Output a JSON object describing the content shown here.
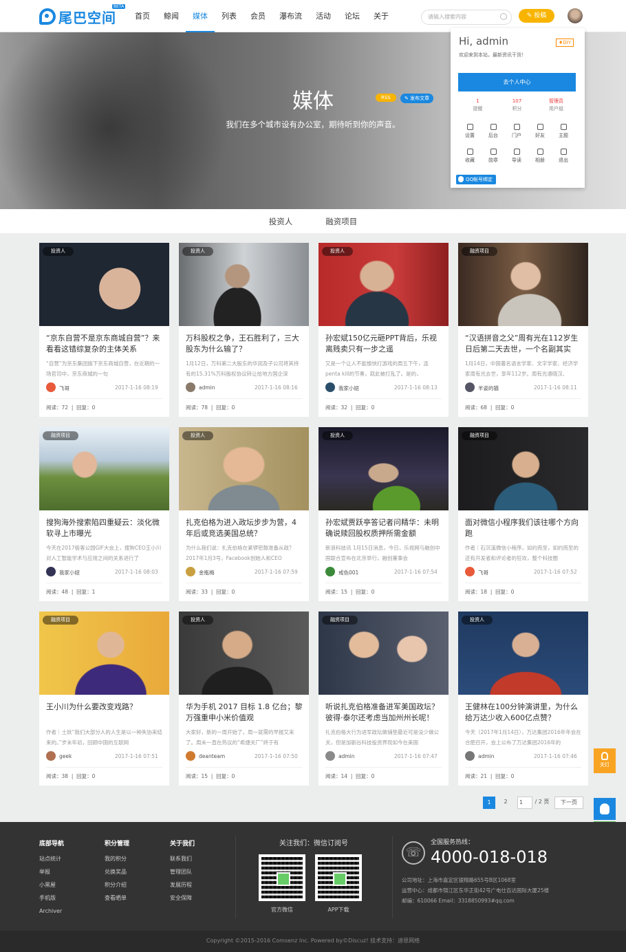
{
  "header": {
    "logo": "尾巴空间",
    "beta": "BETA",
    "nav": [
      "首页",
      "鲸闻",
      "媒体",
      "列表",
      "会员",
      "瀑布流",
      "活动",
      "论坛",
      "关于"
    ],
    "search_placeholder": "请输入搜索内容",
    "post_label": "投稿"
  },
  "hero": {
    "title": "媒体",
    "subtitle": "我们在多个城市设有办公室，期待听到你的声音。",
    "rss": "RSS",
    "publish": "发布文章"
  },
  "user_menu": {
    "greeting": "Hi, admin",
    "diy": "♦DIY",
    "welcome": "欢迎来到本站，最新资讯干货！",
    "center_btn": "去个人中心",
    "stats": [
      {
        "value": "1",
        "label": "提醒"
      },
      {
        "value": "107",
        "label": "积分"
      },
      {
        "value": "管理员",
        "label": "用户组"
      }
    ],
    "items": [
      "设置",
      "后台",
      "门户",
      "好友",
      "主题",
      "收藏",
      "勋章",
      "导读",
      "相册",
      "退出"
    ],
    "qq": "QQ帐号绑定"
  },
  "tabs": [
    "投资人",
    "融资项目"
  ],
  "cards": [
    {
      "tag": "投资人",
      "title": "“京东自营不是京东商城自营”？来看看这错综复杂的主体关系",
      "excerpt": "“自营”为京东集团旗下京东商城自营，在近期的一场官司中，京东商城的一句",
      "author": "飞哥",
      "time": "2017-1-16 08:19",
      "reads": "阅读：72",
      "replies": "回复：0"
    },
    {
      "tag": "投资人",
      "title": "万科股权之争，王石胜利了，三大股东为什么输了？",
      "excerpt": "1月12日，万科第二大股东的华润及子公司将其持有的15.31%万科股权协议转让给地方国企深",
      "author": "admin",
      "time": "2017-1-16 08:16",
      "reads": "阅读：78",
      "replies": "回复：0"
    },
    {
      "tag": "投资人",
      "title": "孙宏斌150亿元砸PPT背后，乐视离贱卖只有一步之遥",
      "excerpt": "又是一个让人不能愉快打游戏的周五下午，连penta kill的节奏，就此被打乱了。是的，",
      "author": "我家小妞",
      "time": "2017-1-16 08:13",
      "reads": "阅读：32",
      "replies": "回复：0"
    },
    {
      "tag": "融资项目",
      "title": "“汉语拼音之父”周有光在112岁生日后第二天去世，一个名副其实",
      "excerpt": "1月14日，中国著名语言学家、文字学家、经济学家周有光去世，享年112岁。周有光通晓汉、",
      "author": "羊姿的猫",
      "time": "2017-1-16 08:11",
      "reads": "阅读：68",
      "replies": "回复：0"
    },
    {
      "tag": "融资项目",
      "title": "搜狗海外搜索陷四重疑云：淡化微软寻上市曝光",
      "excerpt": "今天在2017极客公园GIF大会上，搜狗CEO王小川对人工智能学术与应用之间的关系进行了",
      "author": "我家小妞",
      "time": "2017-1-16 08:03",
      "reads": "阅读：48",
      "replies": "回复：1"
    },
    {
      "tag": "投资人",
      "title": "扎克伯格为进入政坛步步为营，4年后或竞选美国总统？",
      "excerpt": "为什么我们说：扎克伯格在紧锣密鼓准备从政？2017年1月3号，Facebook创始人和CEO",
      "author": "金瓶梅",
      "time": "2017-1-16 07:59",
      "reads": "阅读：33",
      "replies": "回复：0"
    },
    {
      "tag": "投资人",
      "title": "孙宏斌贾跃亭答记者问精华：未明确说赎回股权质押所需金额",
      "excerpt": "新浪科技讯 1月15日消息，今日，乐视网与融创中国联合宣布在北京举行，融创董事会",
      "author": "戒色001",
      "time": "2017-1-16 07:54",
      "reads": "阅读：15",
      "replies": "回复：0"
    },
    {
      "tag": "融资项目",
      "title": "面对微信小程序我们该往哪个方向跑",
      "excerpt": "作者｜石沉溪微信小程序，如约而至，如约而至的还有开发者和评论者的狂欢，整个科技圈",
      "author": "飞哥",
      "time": "2017-1-16 07:52",
      "reads": "阅读：18",
      "replies": "回复：0"
    },
    {
      "tag": "融资项目",
      "title": "王小川为什么要改变戏路？",
      "excerpt": "作者｜土妖“我们大部分人的人生是以一种失协来结束的。”岁末年初，回顾中国的互联网",
      "author": "geek",
      "time": "2017-1-16 07:51",
      "reads": "阅读：38",
      "replies": "回复：0"
    },
    {
      "tag": "投资人",
      "title": "华为手机 2017 目标 1.8 亿台；黎万强重申小米价值观",
      "excerpt": "大家好，新的一周开始了，周一就需的早报又来了。周末一直在热议的“希捷关厂”终于有",
      "author": "deanteam",
      "time": "2017-1-16 07:50",
      "reads": "阅读：15",
      "replies": "回复：0"
    },
    {
      "tag": "融资项目",
      "title": "听说扎克伯格准备进军美国政坛？彼得·泰尔还考虑当加州州长呢！",
      "excerpt": "扎克伯格大行为进军政坛做铺垫最近可是没少做公关，但是加剧谷科技投资界现如今在美国",
      "author": "admin",
      "time": "2017-1-16 07:47",
      "reads": "阅读：14",
      "replies": "回复：0"
    },
    {
      "tag": "投资人",
      "title": "王健林在100分钟演讲里，为什么给万达少收入600亿点赞？",
      "excerpt": "今天（2017年1月14日），万达集团2016年年会在合肥召开，会上公布了万达集团2016年的",
      "author": "admin",
      "time": "2017-1-16 07:46",
      "reads": "阅读：21",
      "replies": "回复：0"
    }
  ],
  "pager": {
    "p1": "1",
    "p2": "2",
    "input": "1",
    "total": "/ 2 页",
    "next": "下一页"
  },
  "side": {
    "top": "关灯"
  },
  "footer": {
    "cols": [
      {
        "head": "底部导航",
        "items": [
          "站点统计",
          "举报",
          "小黑屋",
          "手机版",
          "Archiver"
        ]
      },
      {
        "head": "积分管理",
        "items": [
          "我的积分",
          "兑换奖品",
          "积分介绍",
          "查看晒单"
        ]
      },
      {
        "head": "关于我们",
        "items": [
          "联系我们",
          "管理团队",
          "发展历程",
          "安全保障"
        ]
      }
    ],
    "follow": "关注我们：微信订阅号",
    "qr1": "官方微信",
    "qr2": "APP下载",
    "hotline_label": "全国服务热线：",
    "hotline": "4000-018-018",
    "addr1": "公司地址：上海市嘉定区银翔路655号B区1068室",
    "addr2": "运营中心：成都市锦江区东华正街42号广电仕百达国际大厦25楼",
    "addr3": "邮编：610066 Email：3318850993#qq.com"
  },
  "copyright": "Copyright ©2015-2016 Comsenz Inc. Powered by©Discuz! 技术支持：迪恩网络"
}
